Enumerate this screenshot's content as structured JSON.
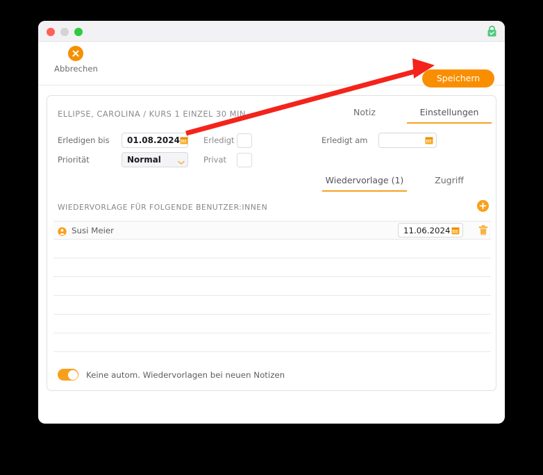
{
  "window": {
    "traffic_lights": [
      "close",
      "minimize",
      "zoom"
    ],
    "lock_icon": "lock-secure-icon",
    "accent_color": "#f98f00",
    "active_tab_underline_color": "#f5a020"
  },
  "toolbar": {
    "cancel_label": "Abbrechen",
    "cancel_icon": "circle-x-icon",
    "save_label": "Speichern"
  },
  "panel": {
    "record_title": "ELLIPSE, CAROLINA / KURS 1 EINZEL 30 MIN",
    "tabs_primary": [
      {
        "label": "Notiz",
        "active": false
      },
      {
        "label": "Einstellungen",
        "active": true
      }
    ],
    "tabs_secondary": [
      {
        "label": "Wiedervorlage (1)",
        "active": true
      },
      {
        "label": "Zugriff",
        "active": false
      }
    ],
    "form": {
      "due_label": "Erledigen bis",
      "due_value": "01.08.2024",
      "priority_label": "Priorität",
      "priority_value": "Normal",
      "done_label": "Erledigt",
      "private_label": "Privat",
      "done_on_label": "Erledigt am",
      "done_on_value": "",
      "calendar_icon": "calendar-icon",
      "chevron_icon": "chevron-down-icon"
    },
    "list": {
      "heading": "WIEDERVORLAGE FÜR FOLGENDE BENUTZER:INNEN",
      "add_icon": "plus-circle-icon",
      "rows": [
        {
          "user_icon": "user-circle-icon",
          "name": "Susi Meier",
          "date": "11.06.2024",
          "calendar_icon": "calendar-icon",
          "delete_icon": "trash-icon"
        }
      ],
      "empty_row_count": 6
    },
    "footer": {
      "toggle_state": "on",
      "toggle_label": "Keine autom. Wiedervorlagen bei neuen Notizen"
    }
  },
  "annotation": {
    "arrow_color": "#f4231b",
    "arrow_points_to": "save-button"
  }
}
